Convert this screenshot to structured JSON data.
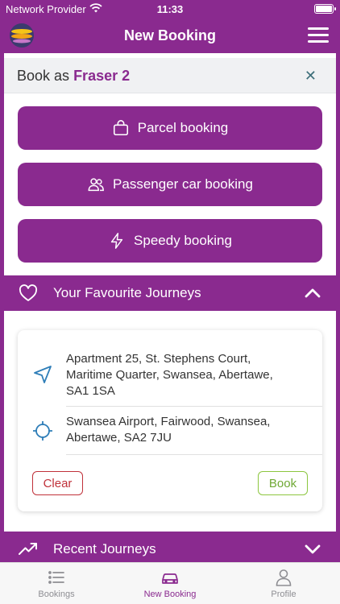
{
  "status_bar": {
    "carrier": "Network Provider",
    "time": "11:33"
  },
  "header": {
    "title": "New Booking"
  },
  "book_as": {
    "prefix": "Book as",
    "user": "Fraser 2",
    "close_glyph": "✕"
  },
  "booking_options": [
    {
      "label": "Parcel booking",
      "icon": "bag-icon"
    },
    {
      "label": "Passenger car booking",
      "icon": "people-icon"
    },
    {
      "label": "Speedy booking",
      "icon": "lightning-icon"
    }
  ],
  "favourites": {
    "title": "Your Favourite Journeys",
    "expanded": true,
    "journeys": [
      {
        "from_lines": [
          "Apartment 25, St. Stephens Court,",
          "Maritime Quarter, Swansea, Abertawe,",
          "SA1 1SA"
        ],
        "to_lines": [
          "Swansea Airport, Fairwood, Swansea,",
          "Abertawe, SA2 7JU"
        ]
      }
    ],
    "clear_label": "Clear",
    "book_label": "Book"
  },
  "recent": {
    "title": "Recent Journeys",
    "expanded": false
  },
  "tabs": [
    {
      "label": "Bookings",
      "icon": "list-icon",
      "active": false
    },
    {
      "label": "New Booking",
      "icon": "car-icon",
      "active": true
    },
    {
      "label": "Profile",
      "icon": "person-icon",
      "active": false
    }
  ],
  "colors": {
    "brand": "#8a2a8f",
    "clear": "#c0313a",
    "book": "#8cc63f",
    "close": "#3e6f7a"
  }
}
